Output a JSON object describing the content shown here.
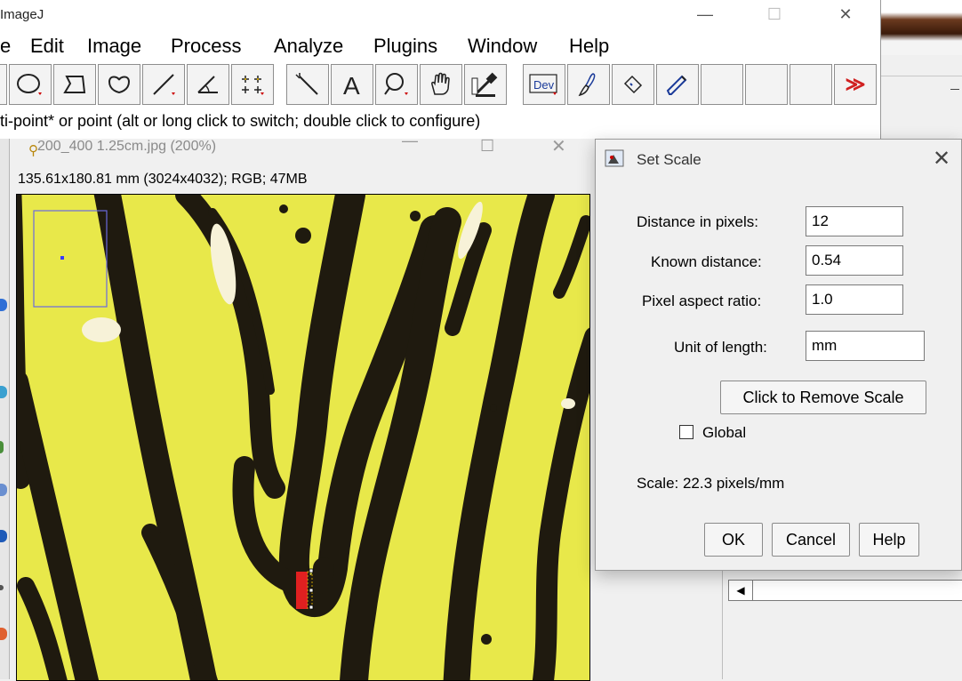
{
  "main_window": {
    "title": "ImageJ",
    "minimize": "—",
    "maximize": "☐",
    "close": "✕",
    "menus": [
      "e",
      "Edit",
      "Image",
      "Process",
      "Analyze",
      "Plugins",
      "Window",
      "Help"
    ],
    "status": "ti-point* or point (alt or long click to switch; double click to configure)",
    "tools": [
      "oval-tool",
      "polygon-tool",
      "freehand-tool",
      "line-tool",
      "angle-tool",
      "multi-point-tool",
      "wand-tool",
      "text-tool",
      "zoom-tool",
      "hand-tool",
      "color-picker-tool",
      "dev-tool",
      "brush-tool",
      "flood-fill-tool",
      "pencil-tool",
      "blank",
      "blank",
      "blank",
      "more-tools"
    ],
    "dev_label": "Dev",
    "more_label": "≫"
  },
  "image_window": {
    "title": "200_400 1.25cm.jpg (200%)",
    "minimize": "—",
    "maximize": "☐",
    "close": "✕",
    "info": "135.61x180.81 mm (3024x4032); RGB; 47MB",
    "colors": {
      "background": "#e9e94a",
      "stripes": "#1f1a0f",
      "highlight": "#f7f2d8",
      "selection": "#e02020"
    }
  },
  "dialog": {
    "title": "Set Scale",
    "close": "✕",
    "fields": [
      {
        "label": "Distance in pixels:",
        "value": "12"
      },
      {
        "label": "Known distance:",
        "value": "0.54"
      },
      {
        "label": "Pixel aspect ratio:",
        "value": "1.0"
      },
      {
        "label": "Unit of length:",
        "value": "mm"
      }
    ],
    "remove_scale": "Click to Remove Scale",
    "global_label": "Global",
    "global_checked": false,
    "scale_text": "Scale: 22.3 pixels/mm",
    "buttons": {
      "ok": "OK",
      "cancel": "Cancel",
      "help": "Help"
    }
  }
}
